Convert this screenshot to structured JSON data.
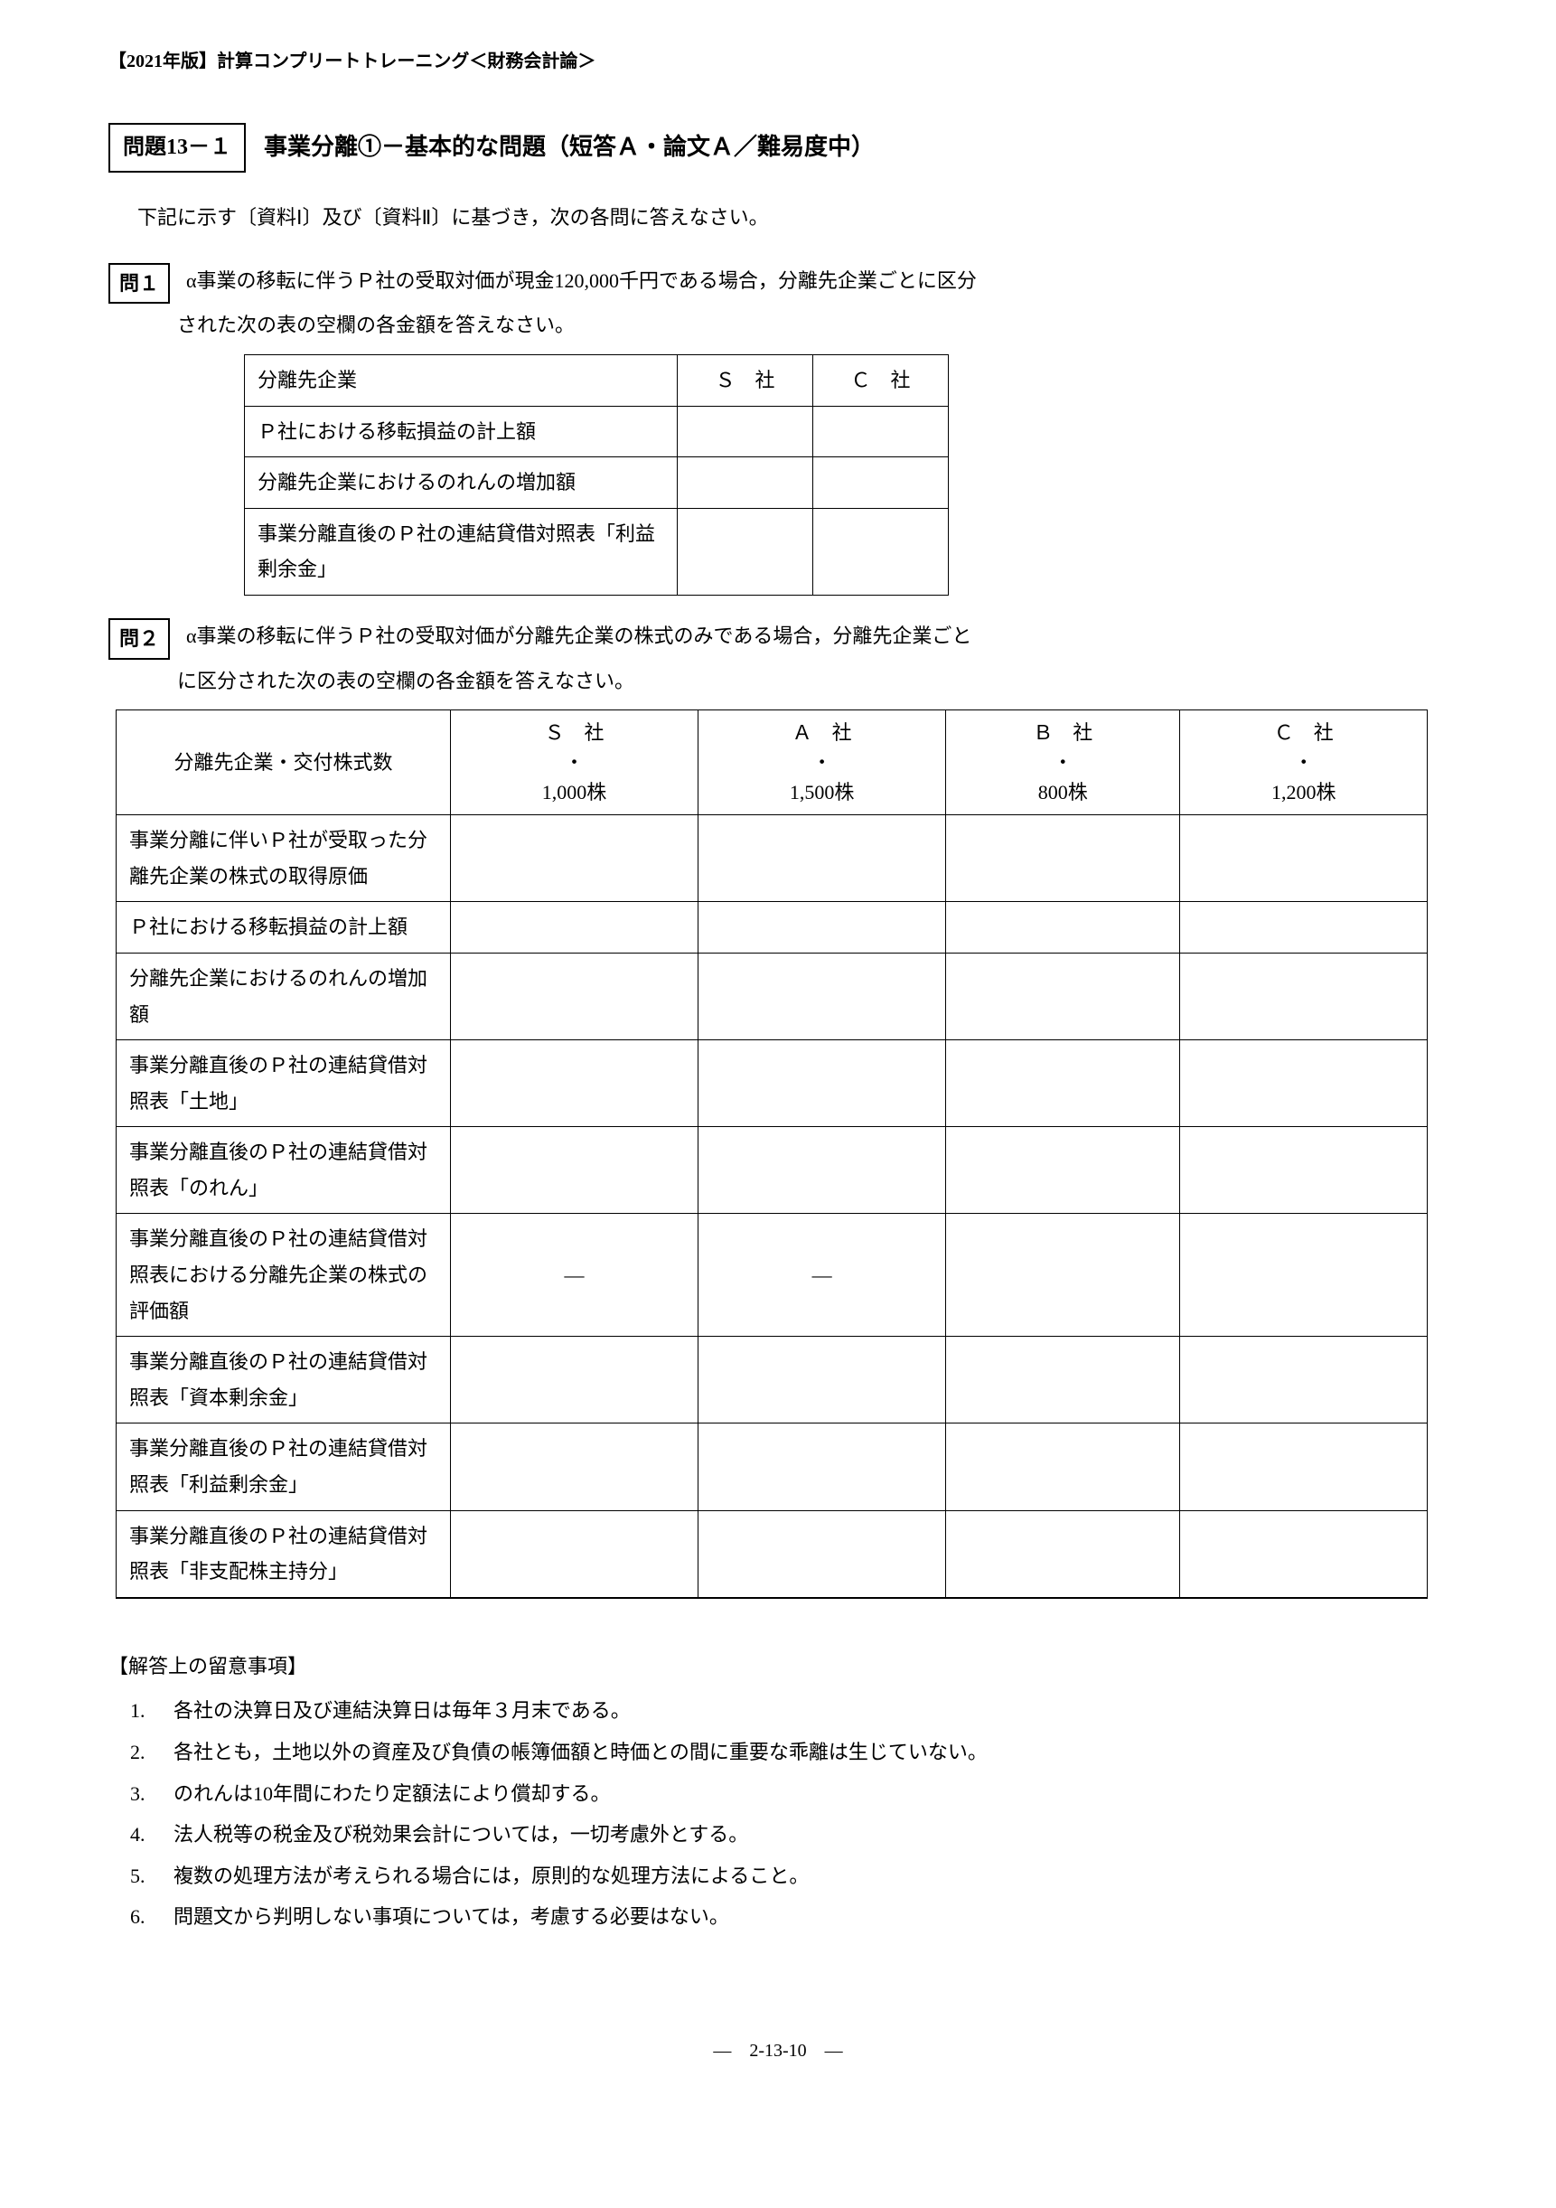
{
  "header": "【2021年版】計算コンプリートトレーニング＜財務会計論＞",
  "problem": {
    "number_label": "問題13－１",
    "title": "事業分離①－基本的な問題（短答Ａ・論文Ａ／難易度中）",
    "intro": "下記に示す〔資料Ⅰ〕及び〔資料Ⅱ〕に基づき，次の各問に答えなさい。"
  },
  "q1": {
    "label": "問１",
    "text_line1": "α事業の移転に伴うＰ社の受取対価が現金120,000千円である場合，分離先企業ごとに区分",
    "text_line2": "された次の表の空欄の各金額を答えなさい。",
    "table": {
      "headers": [
        "分離先企業",
        "Ｓ　社",
        "Ｃ　社"
      ],
      "rows": [
        "Ｐ社における移転損益の計上額",
        "分離先企業におけるのれんの増加額",
        "事業分離直後のＰ社の連結貸借対照表「利益剰余金」"
      ]
    }
  },
  "q2": {
    "label": "問２",
    "text_line1": "α事業の移転に伴うＰ社の受取対価が分離先企業の株式のみである場合，分離先企業ごと",
    "text_line2": "に区分された次の表の空欄の各金額を答えなさい。",
    "table": {
      "row_header_label": "分離先企業・交付株式数",
      "columns": [
        {
          "name": "Ｓ　社",
          "shares": "1,000株"
        },
        {
          "name": "Ａ　社",
          "shares": "1,500株"
        },
        {
          "name": "Ｂ　社",
          "shares": "800株"
        },
        {
          "name": "Ｃ　社",
          "shares": "1,200株"
        }
      ],
      "rows": [
        {
          "label": "事業分離に伴いＰ社が受取った分離先企業の株式の取得原価",
          "cells": [
            "",
            "",
            "",
            ""
          ]
        },
        {
          "label": "Ｐ社における移転損益の計上額",
          "cells": [
            "",
            "",
            "",
            ""
          ]
        },
        {
          "label": "分離先企業におけるのれんの増加額",
          "cells": [
            "",
            "",
            "",
            ""
          ]
        },
        {
          "label": "事業分離直後のＰ社の連結貸借対照表「土地」",
          "cells": [
            "",
            "",
            "",
            ""
          ]
        },
        {
          "label": "事業分離直後のＰ社の連結貸借対照表「のれん」",
          "cells": [
            "",
            "",
            "",
            ""
          ]
        },
        {
          "label": "事業分離直後のＰ社の連結貸借対照表における分離先企業の株式の評価額",
          "cells": [
            "―",
            "―",
            "",
            ""
          ]
        },
        {
          "label": "事業分離直後のＰ社の連結貸借対照表「資本剰余金」",
          "cells": [
            "",
            "",
            "",
            ""
          ]
        },
        {
          "label": "事業分離直後のＰ社の連結貸借対照表「利益剰余金」",
          "cells": [
            "",
            "",
            "",
            ""
          ]
        },
        {
          "label": "事業分離直後のＰ社の連結貸借対照表「非支配株主持分」",
          "cells": [
            "",
            "",
            "",
            ""
          ]
        }
      ]
    }
  },
  "notes": {
    "title": "【解答上の留意事項】",
    "items": [
      {
        "num": "1.",
        "text": "各社の決算日及び連結決算日は毎年３月末である。"
      },
      {
        "num": "2.",
        "text": "各社とも，土地以外の資産及び負債の帳簿価額と時価との間に重要な乖離は生じていない。"
      },
      {
        "num": "3.",
        "text": "のれんは10年間にわたり定額法により償却する。"
      },
      {
        "num": "4.",
        "text": "法人税等の税金及び税効果会計については，一切考慮外とする。"
      },
      {
        "num": "5.",
        "text": "複数の処理方法が考えられる場合には，原則的な処理方法によること。"
      },
      {
        "num": "6.",
        "text": "問題文から判明しない事項については，考慮する必要はない。"
      }
    ]
  },
  "footer": "―　2-13-10　―"
}
